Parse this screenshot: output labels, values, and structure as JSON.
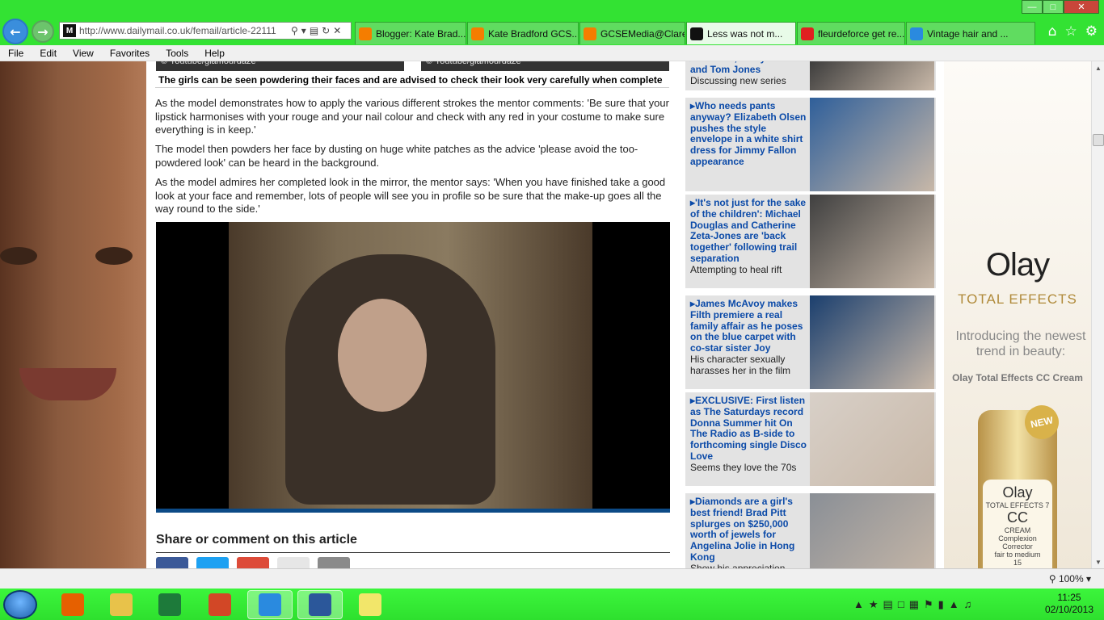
{
  "browser": {
    "url": "http://www.dailymail.co.uk/femail/article-22111",
    "favicon_letter": "M",
    "tabs": [
      {
        "label": "Blogger: Kate Brad...",
        "icon": "blogger-icon",
        "color": "#f57d00"
      },
      {
        "label": "Kate Bradford GCS...",
        "icon": "blogger-icon",
        "color": "#f57d00"
      },
      {
        "label": "GCSEMedia@Clare...",
        "icon": "blogger-icon",
        "color": "#f57d00"
      },
      {
        "label": "Less was not m...",
        "icon": "dailymail-icon",
        "color": "#111111",
        "active": true
      },
      {
        "label": "fleurdeforce get re...",
        "icon": "youtube-icon",
        "color": "#e02020"
      },
      {
        "label": "Vintage hair and ...",
        "icon": "ie-icon",
        "color": "#2a8adf"
      }
    ],
    "menu": [
      "File",
      "Edit",
      "View",
      "Favorites",
      "Tools",
      "Help"
    ],
    "zoom": "100%"
  },
  "article": {
    "top_credits": [
      "© Youtube/glamourdaze",
      "© Youtube/glamourdaze"
    ],
    "caption": "The girls can be seen powdering their faces and are advised to check their look very carefully when complete",
    "paragraphs": [
      "As the model demonstrates how to apply the various different strokes the mentor comments: 'Be sure that your lipstick harmonises with your rouge and your nail colour and check with any red in your costume to make sure everything is in keep.'",
      "The model then powders her face by dusting on huge white patches as the advice 'please avoid the too-powdered look' can be heard in the background.",
      "As the model admires her completed look in the mirror, the mentor says: 'When you have finished take a good look at your face and remember, lots of people will see you in profile so be sure that the make-up goes all the way round to the side.'"
    ],
    "share_heading": "Share or comment on this article",
    "share_colors": [
      "#3b5998",
      "#1da1f2",
      "#dd4b39",
      "#e6e6e6",
      "#8a8a8a"
    ]
  },
  "sidebar": [
    {
      "head": "Will.i.am, Ricky Wilson and Tom Jones",
      "sub": "Discussing new series",
      "tint": "#3a3a3a"
    },
    {
      "head": "Who needs pants anyway? Elizabeth Olsen pushes the style envelope in a white shirt dress for Jimmy Fallon appearance",
      "sub": "",
      "tint": "#2f5f9a"
    },
    {
      "head": "'It's not just for the sake of the children': Michael Douglas and Catherine Zeta-Jones are 'back together' following trail separation",
      "sub": "Attempting to heal rift",
      "tint": "#404040"
    },
    {
      "head": "James McAvoy makes Filth premiere a real family affair as he poses on the blue carpet with co-star sister Joy",
      "sub": "His character sexually harasses her in the film",
      "tint": "#1b3f6e"
    },
    {
      "head": "EXCLUSIVE: First listen as The Saturdays record Donna Summer hit On The Radio as B-side to forthcoming single Disco Love",
      "sub": "Seems they love the 70s",
      "tint": "#d8d0c8"
    },
    {
      "head": "Diamonds are a girl's best friend! Brad Pitt splurges on $250,000 worth of jewels for Angelina Jolie in Hong Kong",
      "sub": "Show his appreciation",
      "tint": "#8a8f96"
    }
  ],
  "ad": {
    "logo": "Olay",
    "line": "TOTAL EFFECTS",
    "text": "Introducing the newest trend in beauty:",
    "product": "Olay Total Effects CC Cream",
    "badge": "NEW",
    "bottle_brand": "Olay",
    "bottle_line": "TOTAL EFFECTS 7",
    "bottle_cc": "CC",
    "bottle_cream": "CREAM",
    "bottle_corrector": "Complexion Corrector",
    "bottle_shade": "fair to medium",
    "bottle_spf": "15"
  },
  "taskbar": {
    "apps": [
      {
        "name": "firefox",
        "color": "#e66000"
      },
      {
        "name": "explorer",
        "color": "#e8c24a"
      },
      {
        "name": "excel",
        "color": "#1d7a3a"
      },
      {
        "name": "powerpoint",
        "color": "#d24726"
      },
      {
        "name": "internet-explorer",
        "color": "#2a8adf",
        "open": true
      },
      {
        "name": "word",
        "color": "#2b579a",
        "open": true
      },
      {
        "name": "sticky-notes",
        "color": "#f2e66a"
      }
    ],
    "time": "11:25",
    "date": "02/10/2013"
  }
}
